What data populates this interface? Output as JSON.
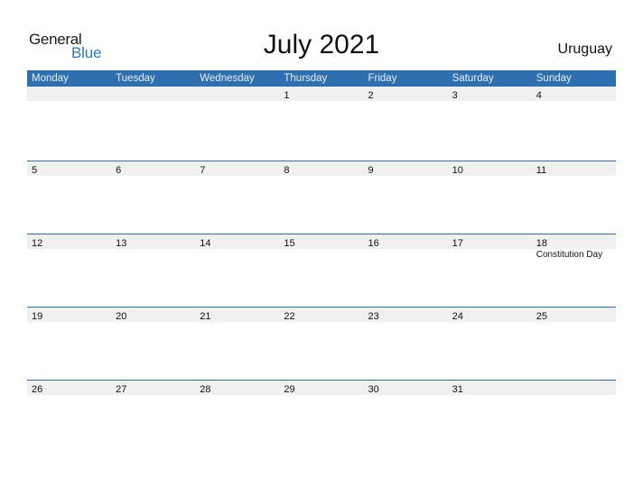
{
  "brand": {
    "line1": "General",
    "line2": "Blue",
    "accent": "#2a78c0"
  },
  "title": "July 2021",
  "country": "Uruguay",
  "colors": {
    "header_bg": "#2e6fb0",
    "row_bg": "#f0f0f0"
  },
  "weekdays": [
    "Monday",
    "Tuesday",
    "Wednesday",
    "Thursday",
    "Friday",
    "Saturday",
    "Sunday"
  ],
  "weeks": [
    {
      "days": [
        {
          "n": ""
        },
        {
          "n": ""
        },
        {
          "n": ""
        },
        {
          "n": "1"
        },
        {
          "n": "2"
        },
        {
          "n": "3"
        },
        {
          "n": "4"
        }
      ]
    },
    {
      "days": [
        {
          "n": "5"
        },
        {
          "n": "6"
        },
        {
          "n": "7"
        },
        {
          "n": "8"
        },
        {
          "n": "9"
        },
        {
          "n": "10"
        },
        {
          "n": "11"
        }
      ]
    },
    {
      "days": [
        {
          "n": "12"
        },
        {
          "n": "13"
        },
        {
          "n": "14"
        },
        {
          "n": "15"
        },
        {
          "n": "16"
        },
        {
          "n": "17"
        },
        {
          "n": "18",
          "event": "Constitution Day"
        }
      ]
    },
    {
      "days": [
        {
          "n": "19"
        },
        {
          "n": "20"
        },
        {
          "n": "21"
        },
        {
          "n": "22"
        },
        {
          "n": "23"
        },
        {
          "n": "24"
        },
        {
          "n": "25"
        }
      ]
    },
    {
      "days": [
        {
          "n": "26"
        },
        {
          "n": "27"
        },
        {
          "n": "28"
        },
        {
          "n": "29"
        },
        {
          "n": "30"
        },
        {
          "n": "31"
        },
        {
          "n": ""
        }
      ]
    }
  ]
}
